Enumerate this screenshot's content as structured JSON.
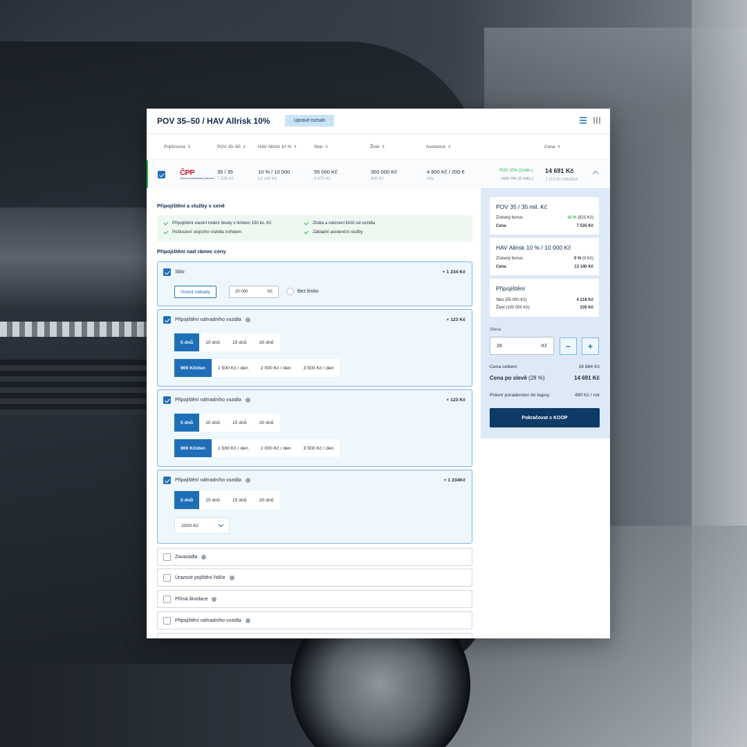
{
  "header": {
    "title": "POV 35–50 / HAV Allrisk 10%",
    "edit_label": "Upravit rozsah"
  },
  "columns": [
    "Pojišťovna",
    "POV 35–50",
    "HAV Allrisk 10 %",
    "Sklo",
    "Živel",
    "Asistence",
    "Cena"
  ],
  "offer_row": {
    "logo_text": "ČPP",
    "logo_sub": "Česká podnikatelská pojišťovna",
    "pov": "35 / 35",
    "pov_sub": "7 535 Kč",
    "hav": "10 % / 10 000",
    "hav_sub": "13 140 Kč",
    "sklo": "55 000 Kč",
    "sklo_sub": "3 670 Kč",
    "zivel": "300 000 Kč",
    "zivel_sub": "900 Kč",
    "asistence": "4 800 Kč / 200 €",
    "asistence_sub": "Info",
    "bonus_pov": "POV 10% (2měs.)",
    "bonus_hav": "HAV 0% (0 měs.)",
    "price": "14 691 Kč",
    "price_sub": "2 113 Kč měsíčně"
  },
  "included": {
    "title": "Připojištění a služby v ceně",
    "items": [
      "Připojištění vlastní totální škody s limitem 150 tis. Kč",
      "Poškození stojícího vozidla zvířetem",
      "Ztráta a odcizení klíčů od vozidla",
      "Základní asistenční služby"
    ]
  },
  "extras": {
    "title": "Připojištění nad rámec ceny",
    "sklo": {
      "label": "Sklo",
      "price": "+ 1 234 Kč",
      "estimate_label": "Ocenit náklady",
      "limit_value": "20 000",
      "limit_unit": "Kč",
      "no_limit_label": "Bez limitu"
    },
    "replacement_1": {
      "label": "Připojištění náhradního vozidla",
      "price": "+ 123 Kč",
      "days": [
        "5 dnů",
        "10 dnů",
        "15 dnů",
        "20 dnů"
      ],
      "rates": [
        "900 Kč/den",
        "1 500 Kč / den",
        "2 000 Kč / den",
        "3 500  Kč / den"
      ]
    },
    "replacement_2": {
      "label": "Připojištění náhradního vozidla",
      "price": "+ 123 Kč",
      "days": [
        "5 dnů",
        "10 dnů",
        "15 dnů",
        "20 dnů"
      ],
      "rates": [
        "900 Kč/den",
        "1 500 Kč / den",
        "2 000 Kč / den",
        "3 500  Kč / den"
      ]
    },
    "replacement_3": {
      "label": "Připojištění náhradního vozidla",
      "price": "+ 1 234Kč",
      "days": [
        "5 dnů",
        "10 dnů",
        "15 dnů",
        "20 dnů"
      ],
      "dropdown_value": "2000 Kč"
    },
    "options": [
      "Zavazadla",
      "Úrazové pojištění řidiče",
      "Přímá likvidace",
      "Připojištění náhradního vozidla"
    ]
  },
  "summary": {
    "pov_card": {
      "title": "POV 35 / 35 mil. Kč",
      "bonus_label": "Získaný bonus",
      "bonus_pct": "10 %",
      "bonus_val": "(821 Kč)",
      "price_label": "Cena",
      "price": "7 535 Kč"
    },
    "hav_card": {
      "title": "HAV Allrisk 10 % / 10 000 Kč",
      "bonus_label": "Získaný bonus",
      "bonus_pct": "0 %",
      "bonus_val": "(0 Kč)",
      "price_label": "Cena",
      "price": "13 140 Kč"
    },
    "extra_card": {
      "title": "Připojištění",
      "line1_label": "Sklo (55 000 Kč)",
      "line1_val": "4 218 Kč",
      "line2_label": "Živel (100 000 Kč)",
      "line2_val": "230 Kč"
    },
    "discount_label": "Sleva",
    "discount_value": "28",
    "discount_unit": "Kč",
    "total_label": "Cena celkem",
    "total_value": "18 884 Kč",
    "after_label": "Cena po slevě",
    "after_pct": "(28 %)",
    "after_value": "14 691 Kč",
    "legal_label": "Právní poradenství do kapsy",
    "legal_value": "490 Kč / rok",
    "cta_label": "Pokračovat s KOOP"
  }
}
